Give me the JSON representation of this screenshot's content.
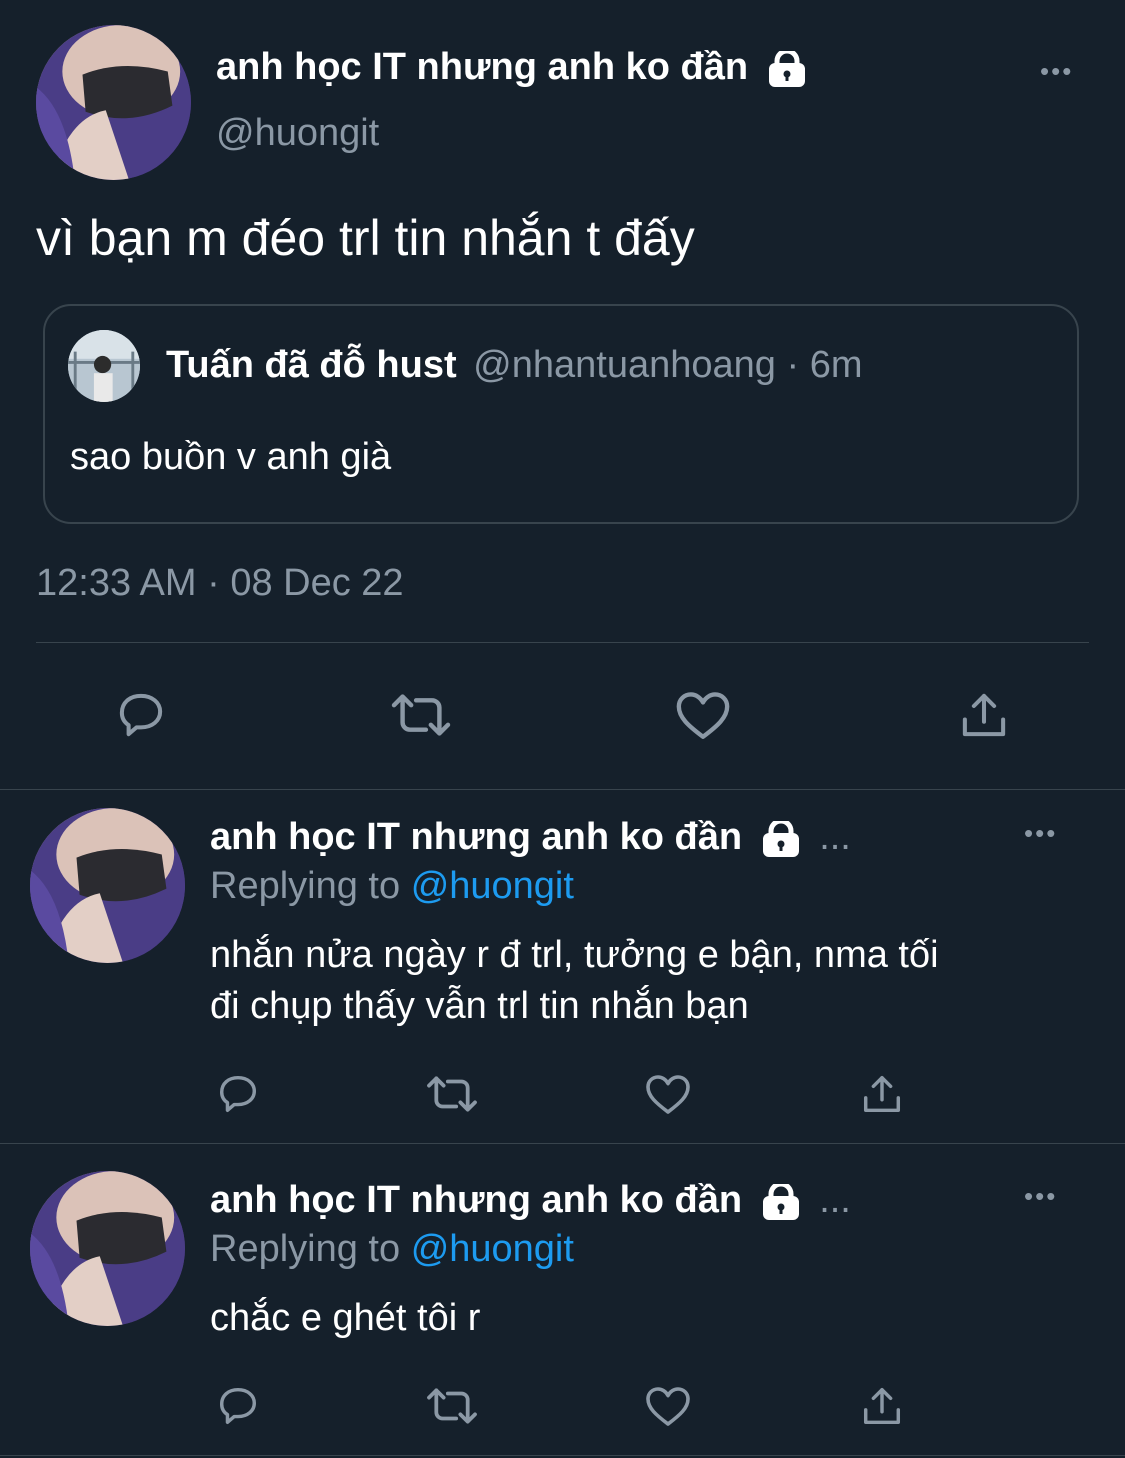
{
  "main_tweet": {
    "display_name": "anh học IT nhưng anh ko đần",
    "handle": "@huongit",
    "text": "vì bạn m đéo trl tin nhắn t đấy",
    "timestamp": "12:33 AM · 08 Dec 22",
    "more_label": "•••",
    "quoted": {
      "display_name": "Tuấn đã đỗ hust",
      "handle": "@nhantuanhoang",
      "time": "· 6m",
      "text": "sao buồn v anh già"
    }
  },
  "replies": [
    {
      "display_name": "anh học IT nhưng anh ko đần",
      "ellipsis": "...",
      "more_label": "•••",
      "replying_prefix": "Replying to",
      "replying_handle": "@huongit",
      "text_line1": "nhắn nửa ngày r đ trl, tưởng e bận, nma tối",
      "text_line2": "đi chụp thấy vẫn trl tin nhắn bạn"
    },
    {
      "display_name": "anh học IT nhưng anh ko đần",
      "ellipsis": "...",
      "more_label": "•••",
      "replying_prefix": "Replying to",
      "replying_handle": "@huongit",
      "text_line1": "chắc e ghét tôi r"
    }
  ],
  "colors": {
    "background": "#15202b",
    "text": "#ffffff",
    "muted": "#8b98a5",
    "link": "#1d9bf0",
    "divider": "#38444d"
  },
  "icons": [
    "lock-icon",
    "reply-icon",
    "retweet-icon",
    "like-icon",
    "share-icon",
    "more-icon"
  ]
}
